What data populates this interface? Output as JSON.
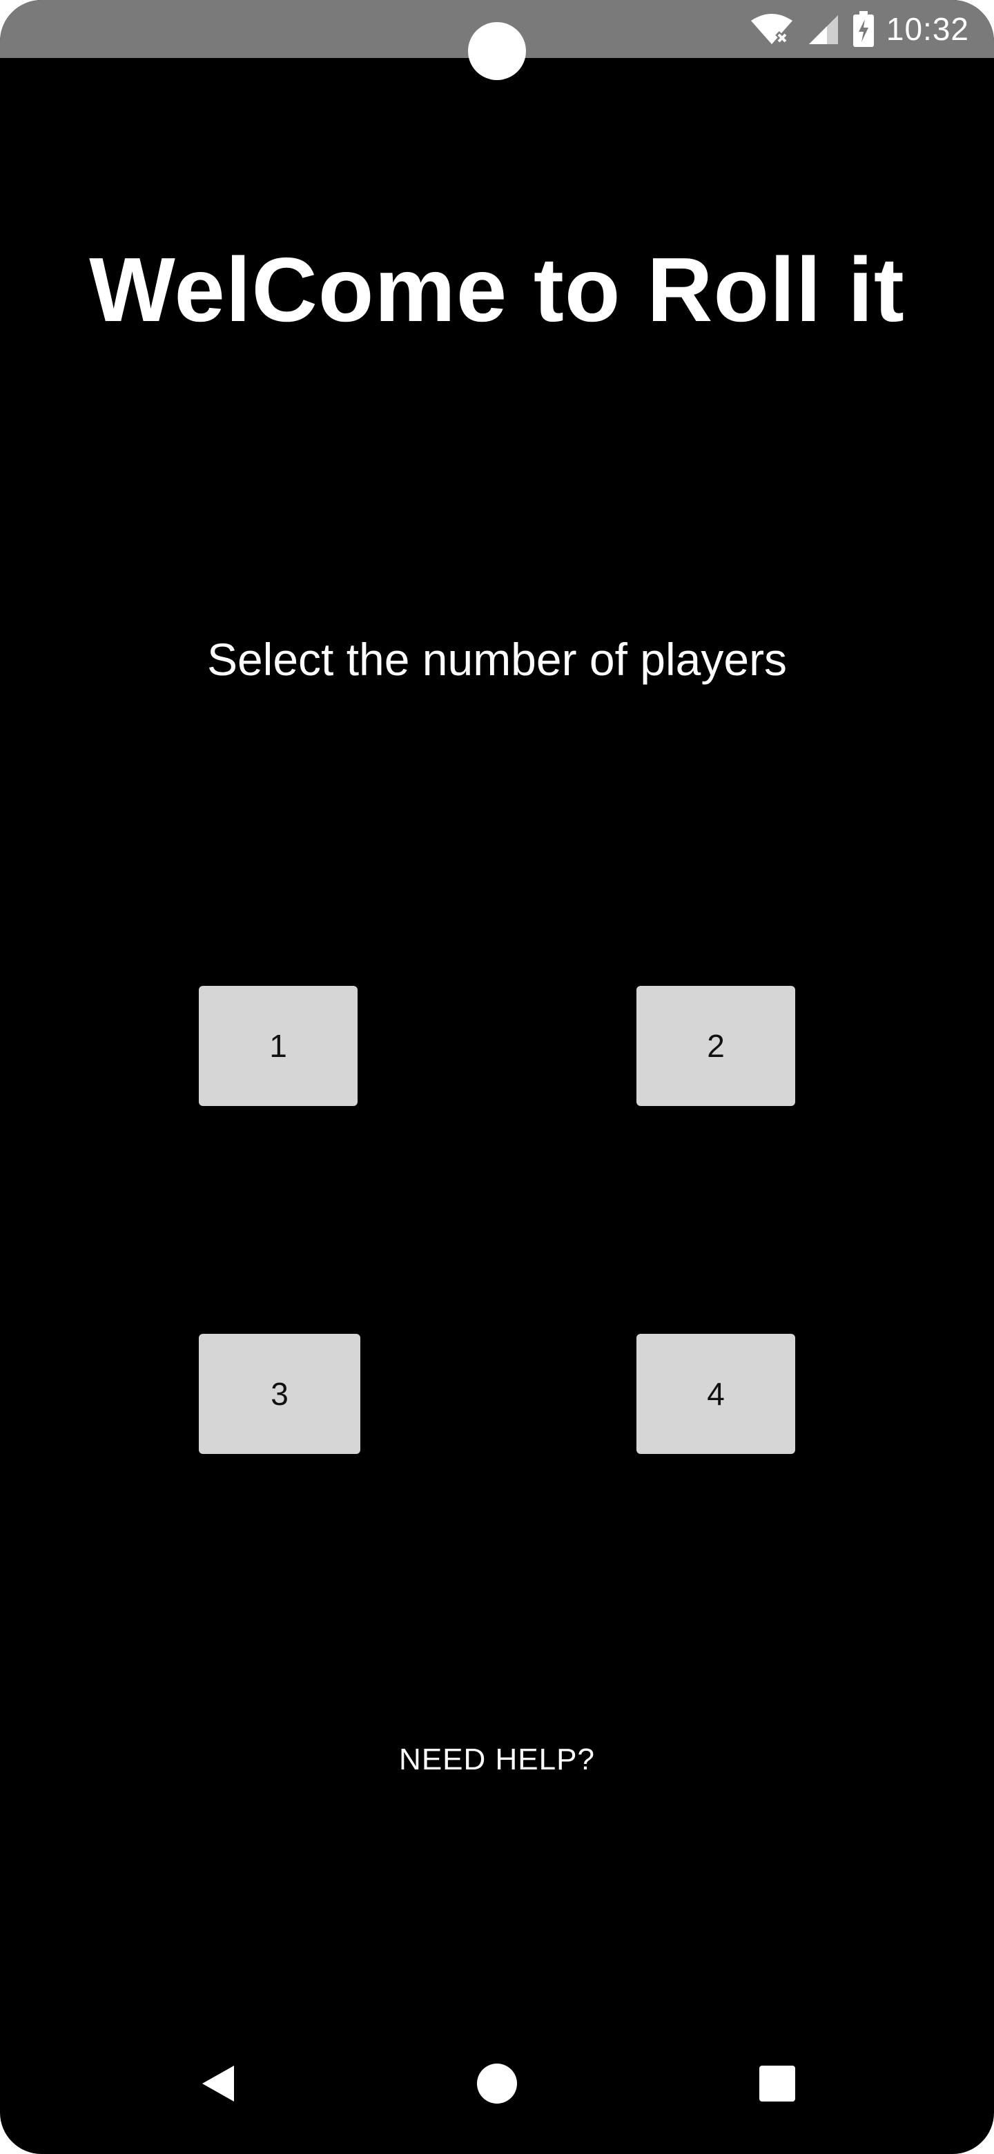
{
  "status_bar": {
    "time": "10:32",
    "icons": [
      "wifi-off-icon",
      "cell-signal-icon",
      "battery-charging-icon"
    ]
  },
  "main": {
    "title": "WelCome to Roll it",
    "prompt": "Select the number of players",
    "player_buttons": [
      {
        "label": "1"
      },
      {
        "label": "2"
      },
      {
        "label": "3"
      },
      {
        "label": "4"
      }
    ],
    "help_label": "NEED HELP?"
  },
  "nav_bar": {
    "icons": [
      "back-icon",
      "home-icon",
      "recents-icon"
    ]
  },
  "colors": {
    "background": "#000000",
    "status_bar": "#7a7a7a",
    "button": "#d5d6d5",
    "text": "#ffffff"
  }
}
